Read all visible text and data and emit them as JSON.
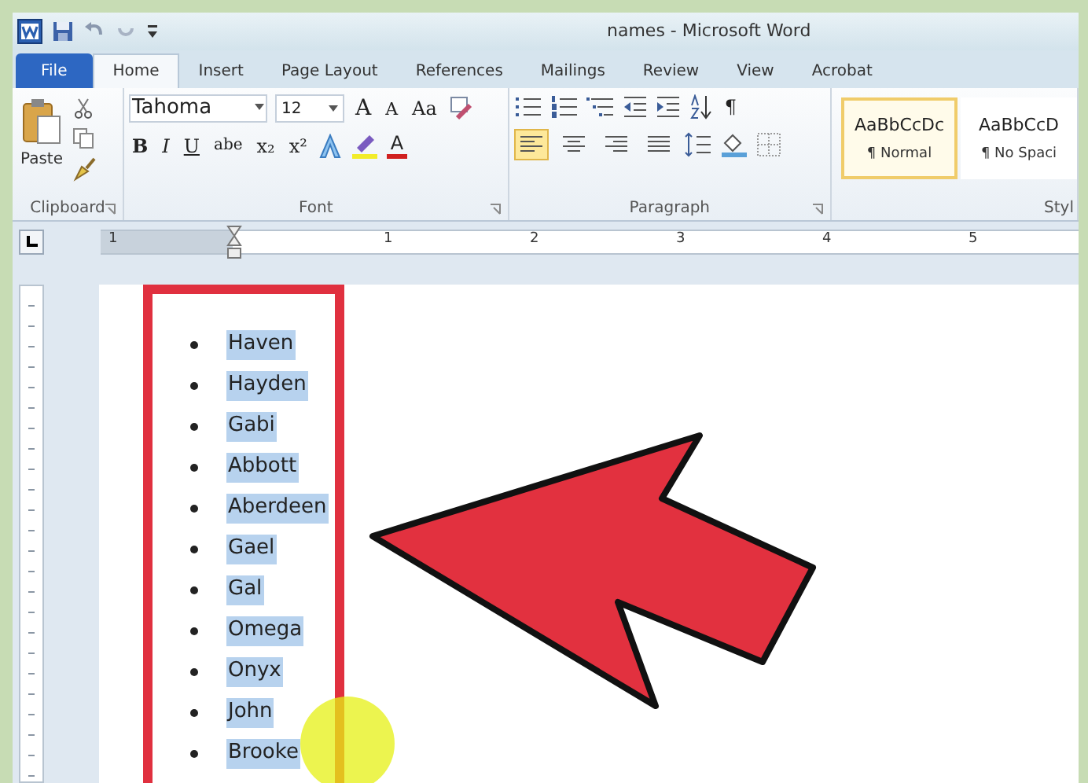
{
  "window": {
    "title": "names - Microsoft Word"
  },
  "tabs": [
    {
      "label": "File",
      "kind": "file",
      "selected": false
    },
    {
      "label": "Home",
      "kind": "tab",
      "selected": true
    },
    {
      "label": "Insert",
      "kind": "tab",
      "selected": false
    },
    {
      "label": "Page Layout",
      "kind": "tab",
      "selected": false
    },
    {
      "label": "References",
      "kind": "tab",
      "selected": false
    },
    {
      "label": "Mailings",
      "kind": "tab",
      "selected": false
    },
    {
      "label": "Review",
      "kind": "tab",
      "selected": false
    },
    {
      "label": "View",
      "kind": "tab",
      "selected": false
    },
    {
      "label": "Acrobat",
      "kind": "tab",
      "selected": false
    }
  ],
  "clipboard": {
    "paste": "Paste",
    "label": "Clipboard"
  },
  "font": {
    "name": "Tahoma",
    "size": "12",
    "grow": "A",
    "shrink": "A",
    "case": "Aa",
    "bold": "B",
    "italic": "I",
    "underline": "U",
    "strike": "abe",
    "subscript": "x₂",
    "superscript": "x²",
    "color_letter": "A",
    "label": "Font"
  },
  "paragraph": {
    "pilcrow": "¶",
    "label": "Paragraph"
  },
  "styles": {
    "items": [
      {
        "preview": "AaBbCcDc",
        "name": "¶ Normal",
        "selected": true
      },
      {
        "preview": "AaBbCcD",
        "name": "¶ No Spaci",
        "selected": false
      }
    ],
    "label": "Styl"
  },
  "ruler": {
    "labels": [
      "1",
      "1",
      "2",
      "3",
      "4",
      "5"
    ]
  },
  "document": {
    "items": [
      {
        "text": "Haven",
        "selected": true
      },
      {
        "text": "Hayden",
        "selected": true
      },
      {
        "text": "Gabi",
        "selected": true
      },
      {
        "text": "Abbott",
        "selected": true
      },
      {
        "text": "Aberdeen",
        "selected": true
      },
      {
        "text": "Gael",
        "selected": true
      },
      {
        "text": "Gal",
        "selected": true
      },
      {
        "text": "Omega",
        "selected": true
      },
      {
        "text": "Onyx",
        "selected": true
      },
      {
        "text": "John",
        "selected": true
      },
      {
        "text": "Brooke",
        "selected": true
      }
    ]
  }
}
